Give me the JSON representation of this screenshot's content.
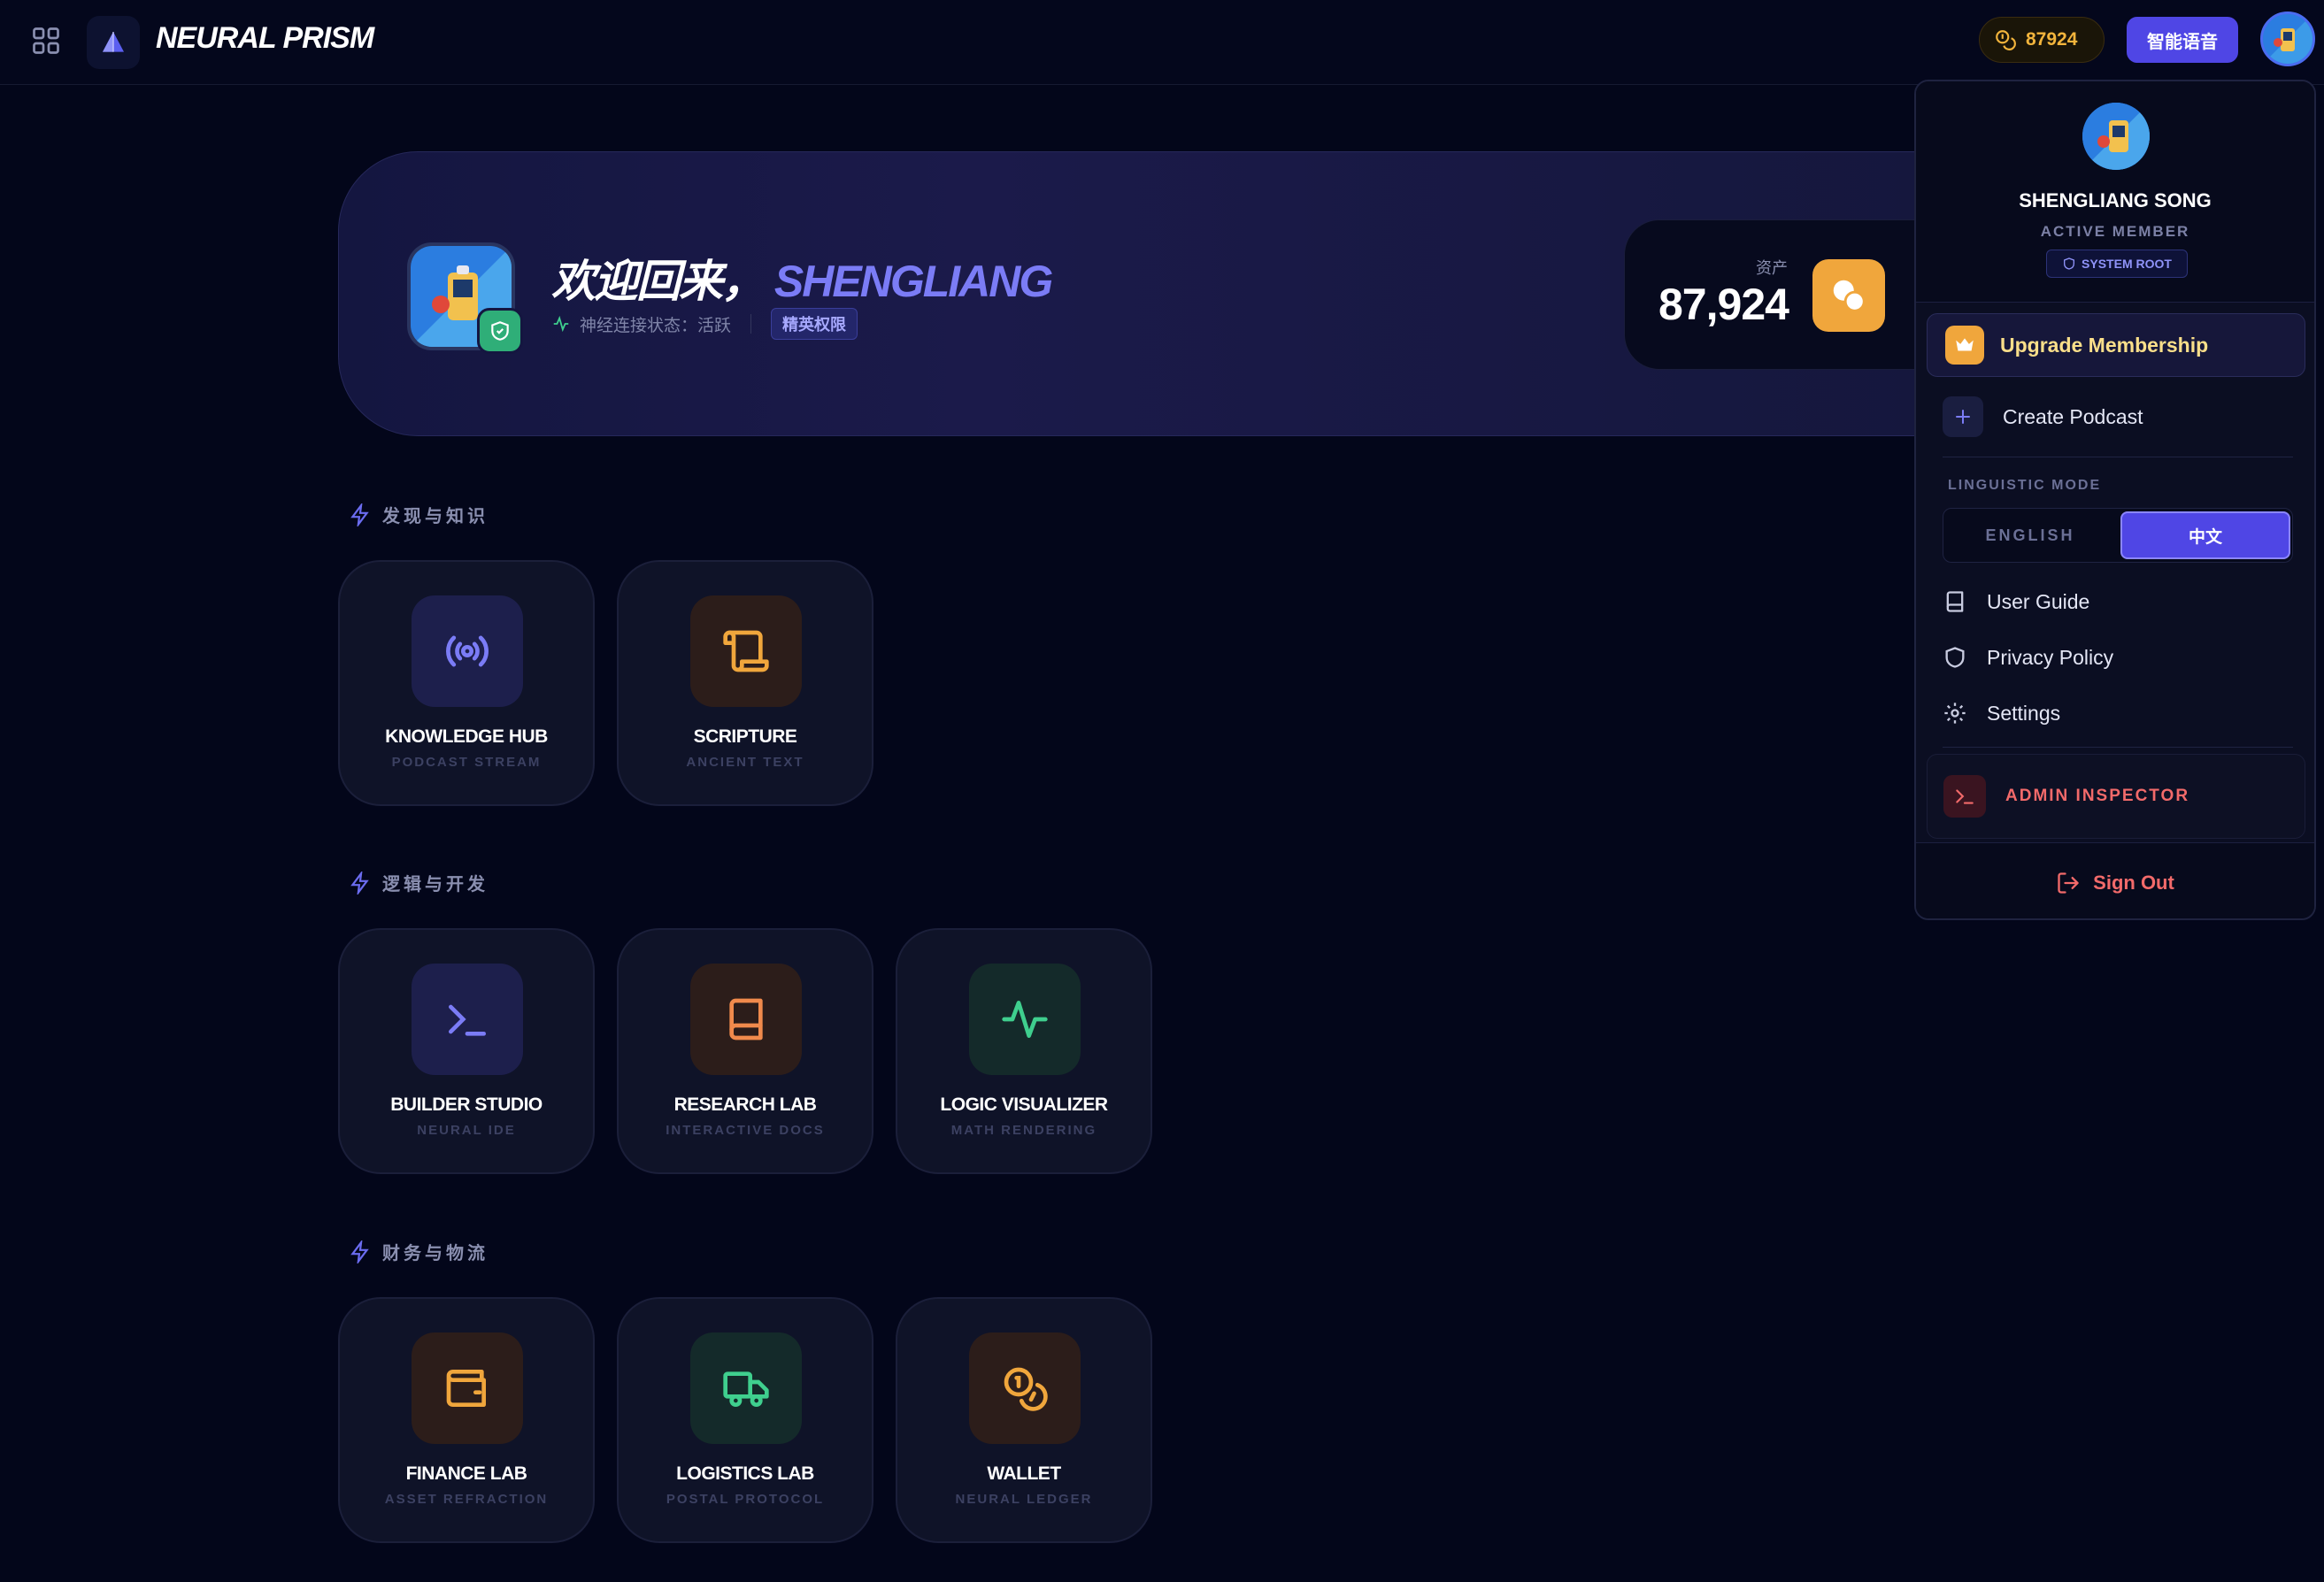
{
  "topbar": {
    "brand": "NEURAL PRISM",
    "coins": "87924",
    "voice_button": "智能语音"
  },
  "hero": {
    "welcome": "欢迎回来，",
    "user_name": "SHENGLIANG",
    "status": "神经连接状态：活跃",
    "tier_badge": "精英权限",
    "asset_label": "资产",
    "asset_value": "87,924"
  },
  "sections": [
    {
      "title": "发现与知识",
      "cards": [
        {
          "title": "KNOWLEDGE HUB",
          "subtitle": "PODCAST STREAM",
          "icon": "broadcast-icon",
          "color": "#6b6cf0"
        },
        {
          "title": "SCRIPTURE",
          "subtitle": "ANCIENT TEXT",
          "icon": "scroll-icon",
          "color": "#f0a63c"
        }
      ]
    },
    {
      "title": "逻辑与开发",
      "cards": [
        {
          "title": "BUILDER STUDIO",
          "subtitle": "NEURAL IDE",
          "icon": "terminal-icon",
          "color": "#6b6cf0"
        },
        {
          "title": "RESEARCH LAB",
          "subtitle": "INTERACTIVE DOCS",
          "icon": "book-icon",
          "color": "#f08a4c"
        },
        {
          "title": "LOGIC VISUALIZER",
          "subtitle": "MATH RENDERING",
          "icon": "activity-icon",
          "color": "#3fcf8e"
        }
      ]
    },
    {
      "title": "财务与物流",
      "cards": [
        {
          "title": "FINANCE LAB",
          "subtitle": "ASSET REFRACTION",
          "icon": "wallet-icon",
          "color": "#f0a63c"
        },
        {
          "title": "LOGISTICS LAB",
          "subtitle": "POSTAL PROTOCOL",
          "icon": "truck-icon",
          "color": "#3fcf8e"
        },
        {
          "title": "WALLET",
          "subtitle": "NEURAL LEDGER",
          "icon": "coins-icon",
          "color": "#f0a63c"
        }
      ]
    }
  ],
  "dropdown": {
    "name": "SHENGLIANG SONG",
    "role": "ACTIVE MEMBER",
    "root_badge": "SYSTEM ROOT",
    "upgrade": "Upgrade Membership",
    "create_podcast": "Create Podcast",
    "linguistic_label": "LINGUISTIC MODE",
    "lang_english": "ENGLISH",
    "lang_chinese": "中文",
    "selected_language": "中文",
    "user_guide": "User Guide",
    "privacy_policy": "Privacy Policy",
    "settings": "Settings",
    "admin_inspector": "ADMIN INSPECTOR",
    "sign_out": "Sign Out"
  },
  "colors": {
    "accent": "#4f46e5",
    "gold": "#f0a63c",
    "green": "#3fcf8e",
    "danger": "#f26a6a",
    "background": "#03061a"
  }
}
